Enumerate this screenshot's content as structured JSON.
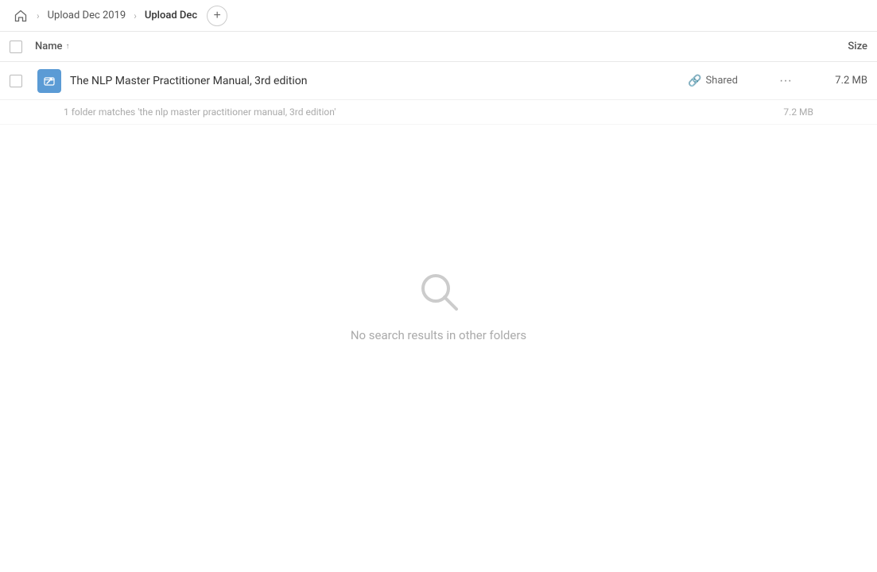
{
  "breadcrumb": {
    "home_icon": "🏠",
    "items": [
      {
        "label": "Upload Dec 2019",
        "active": false
      },
      {
        "label": "Upload Dec",
        "active": true
      }
    ],
    "add_button_label": "+"
  },
  "column_headers": {
    "name_label": "Name",
    "sort_indicator": "↑",
    "size_label": "Size"
  },
  "file_row": {
    "name": "The NLP Master Practitioner Manual, 3rd edition",
    "shared_label": "Shared",
    "size": "7.2 MB",
    "link_icon": "🔗",
    "more_icon": "···"
  },
  "match_info": {
    "text": "1 folder matches 'the nlp master practitioner manual, 3rd edition'",
    "size": "7.2 MB"
  },
  "empty_state": {
    "message": "No search results in other folders"
  }
}
